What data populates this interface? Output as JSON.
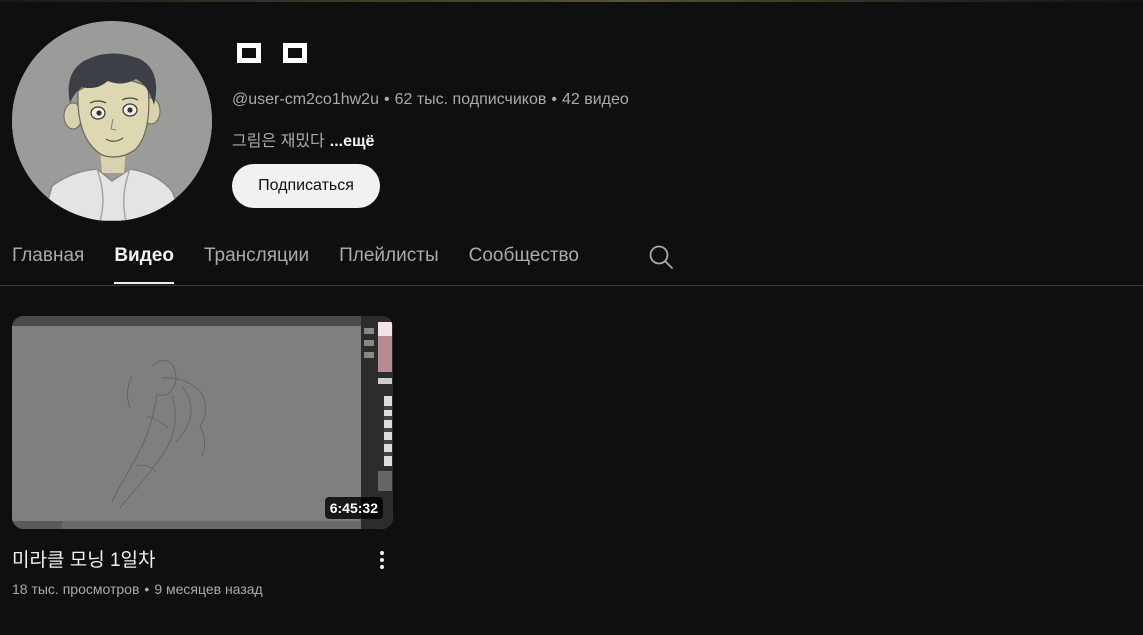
{
  "channel": {
    "name_glyph_count": 2,
    "handle": "@user-cm2co1hw2u",
    "subscribers": "62 тыс. подписчиков",
    "video_count": "42 видео",
    "separator": "•",
    "description": "그림은 재밌다",
    "more_label": "...ещё",
    "subscribe_label": "Подписаться"
  },
  "tabs": [
    {
      "label": "Главная",
      "active": false
    },
    {
      "label": "Видео",
      "active": true
    },
    {
      "label": "Трансляции",
      "active": false
    },
    {
      "label": "Плейлисты",
      "active": false
    },
    {
      "label": "Сообщество",
      "active": false
    }
  ],
  "icons": {
    "search": "search-icon",
    "more": "more-vert-icon"
  },
  "videos": [
    {
      "title": "미라클 모닝 1일차",
      "duration": "6:45:32",
      "views": "18 тыс. просмотров",
      "age": "9 месяцев назад"
    }
  ],
  "colors": {
    "background": "#0f0f0f",
    "text_primary": "#f1f1f1",
    "text_secondary": "#aaaaaa",
    "button_bg": "#f1f1f1",
    "divider": "#3f3f3f"
  }
}
